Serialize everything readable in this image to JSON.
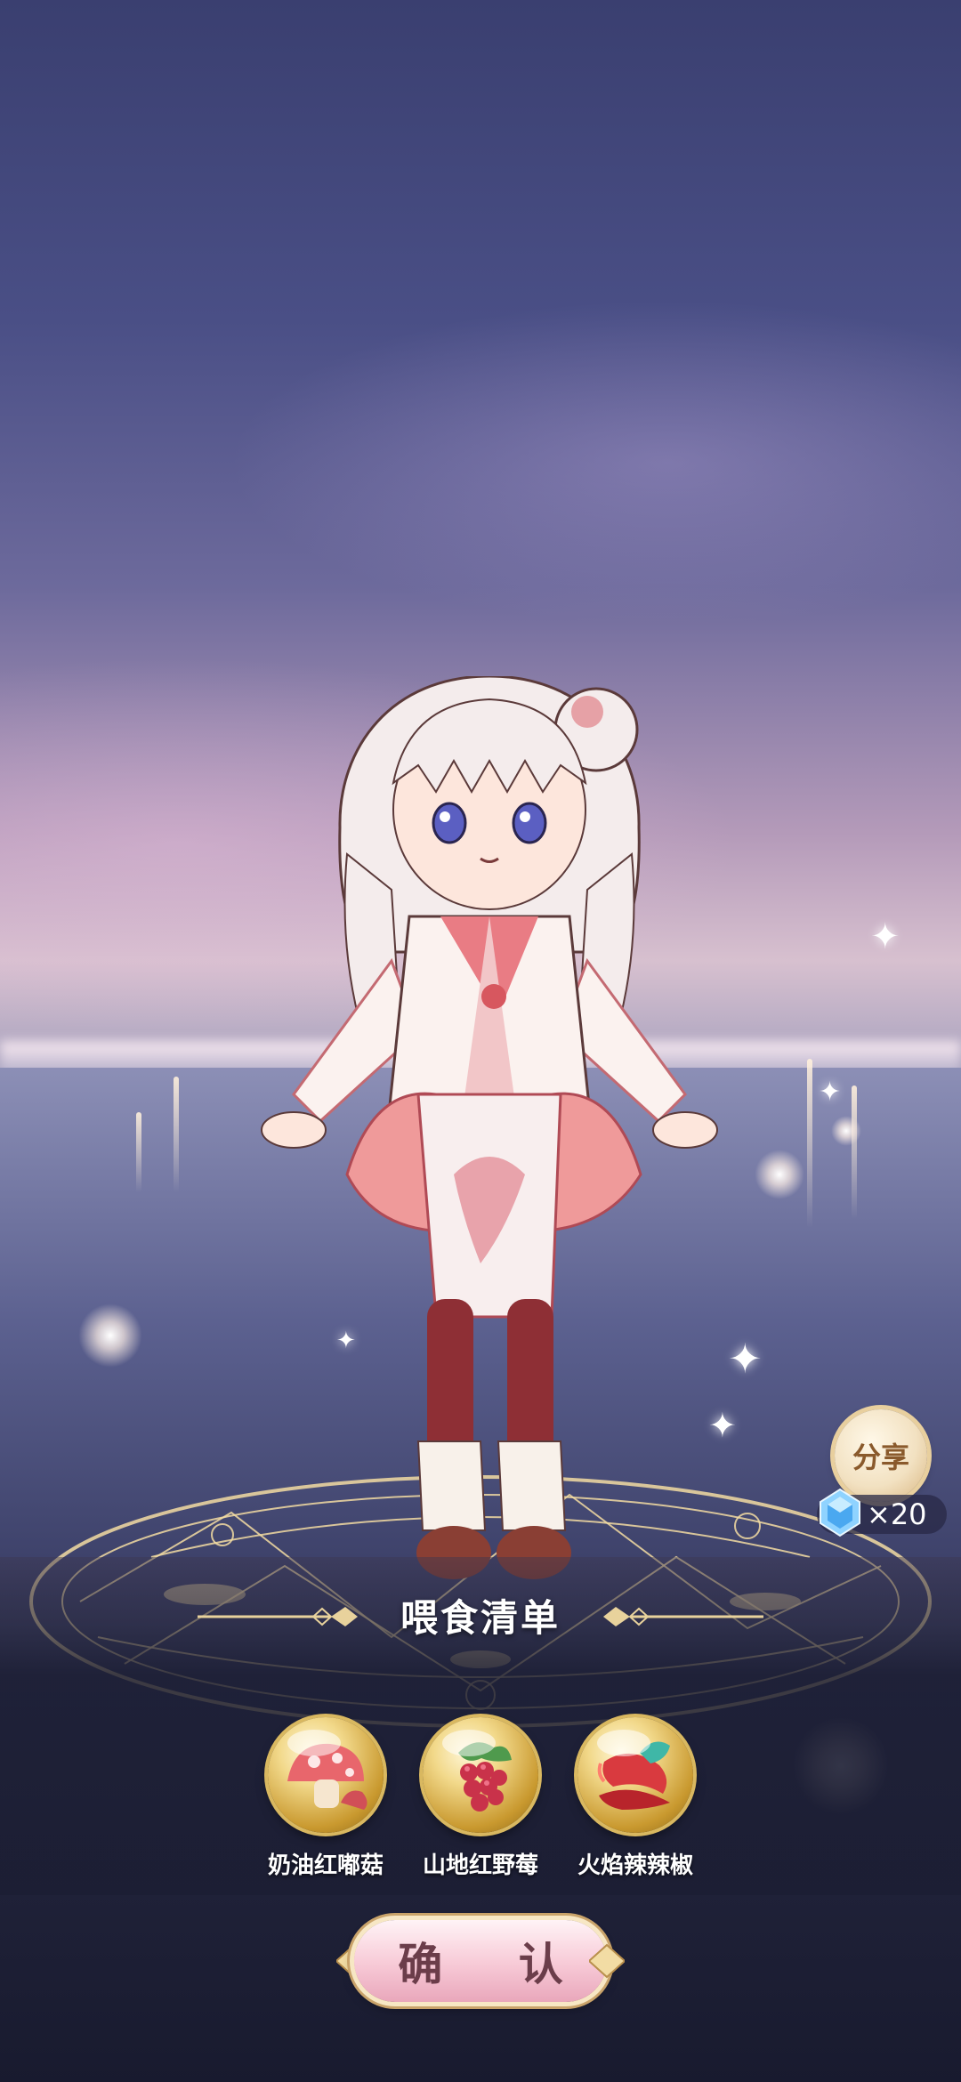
{
  "share": {
    "label": "分享",
    "reward": "×20",
    "reward_icon": "crystal-gem-icon"
  },
  "feed_list": {
    "title": "喂食清单",
    "items": [
      {
        "name": "奶油红嘟菇",
        "icon": "mushroom-icon"
      },
      {
        "name": "山地红野莓",
        "icon": "raspberry-icon"
      },
      {
        "name": "火焰辣辣椒",
        "icon": "chili-pepper-icon"
      }
    ]
  },
  "confirm": {
    "label": "确 认"
  },
  "colors": {
    "accent_gold": "#d9b860",
    "confirm_pink": "#f7c9d6",
    "title_text": "#ffffff"
  }
}
